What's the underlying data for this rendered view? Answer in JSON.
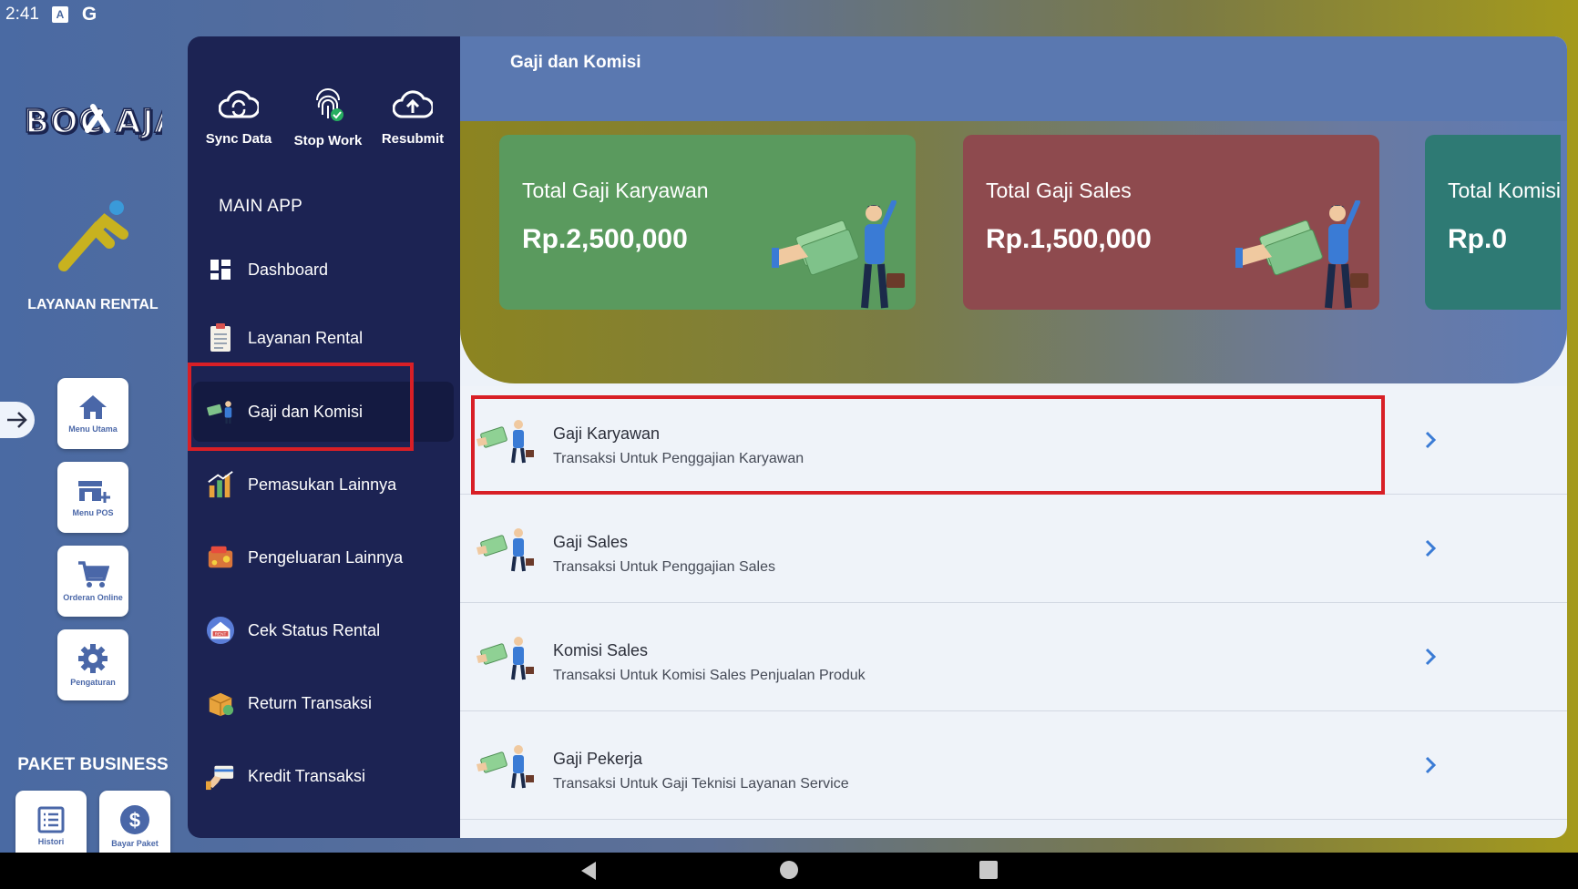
{
  "status_bar": {
    "time": "2:41",
    "icons": [
      "a-notification-icon",
      "google-icon"
    ]
  },
  "rail": {
    "logo_text": "BOC AJA",
    "section_title": "LAYANAN RENTAL",
    "buttons": [
      {
        "label": "Menu Utama",
        "icon": "home-icon"
      },
      {
        "label": "Menu POS",
        "icon": "pos-store-icon"
      },
      {
        "label": "Orderan Online",
        "icon": "cart-icon"
      },
      {
        "label": "Pengaturan",
        "icon": "gear-icon"
      }
    ],
    "paket_title": "PAKET BUSINESS",
    "paket_buttons": [
      {
        "label": "Histori",
        "icon": "list-icon"
      },
      {
        "label": "Bayar Paket",
        "icon": "dollar-icon"
      }
    ]
  },
  "drawer": {
    "quick_actions": [
      {
        "label": "Sync Data",
        "icon": "cloud-sync-icon"
      },
      {
        "label": "Stop Work",
        "icon": "fingerprint-icon"
      },
      {
        "label": "Resubmit",
        "icon": "cloud-upload-icon"
      }
    ],
    "section_label": "MAIN APP",
    "items": [
      {
        "label": "Dashboard",
        "icon": "dashboard-icon"
      },
      {
        "label": "Layanan Rental",
        "icon": "clipboard-icon"
      },
      {
        "label": "Gaji dan Komisi",
        "icon": "salary-icon",
        "active": true
      },
      {
        "label": "Pemasukan Lainnya",
        "icon": "income-icon"
      },
      {
        "label": "Pengeluaran Lainnya",
        "icon": "expense-icon"
      },
      {
        "label": "Cek Status Rental",
        "icon": "rent-status-icon"
      },
      {
        "label": "Return Transaksi",
        "icon": "return-box-icon"
      },
      {
        "label": "Kredit Transaksi",
        "icon": "credit-card-icon"
      }
    ]
  },
  "main": {
    "title": "Gaji dan Komisi",
    "cards": [
      {
        "title": "Total Gaji Karyawan",
        "value": "Rp.2,500,000",
        "color": "#5a9a5e"
      },
      {
        "title": "Total Gaji Sales",
        "value": "Rp.1,500,000",
        "color": "#8e4a4e"
      },
      {
        "title": "Total Komisi",
        "value": "Rp.0",
        "color": "#2e7a74"
      }
    ],
    "rows": [
      {
        "title": "Gaji Karyawan",
        "subtitle": "Transaksi Untuk Penggajian Karyawan"
      },
      {
        "title": "Gaji Sales",
        "subtitle": "Transaksi Untuk Penggajian Sales"
      },
      {
        "title": "Komisi Sales",
        "subtitle": "Transaksi Untuk Komisi Sales Penjualan Produk"
      },
      {
        "title": "Gaji Pekerja",
        "subtitle": "Transaksi Untuk Gaji Teknisi Layanan Service"
      }
    ]
  },
  "colors": {
    "drawer": "#1c2353",
    "accent": "#3a7bd5",
    "highlight": "#d81f26"
  }
}
